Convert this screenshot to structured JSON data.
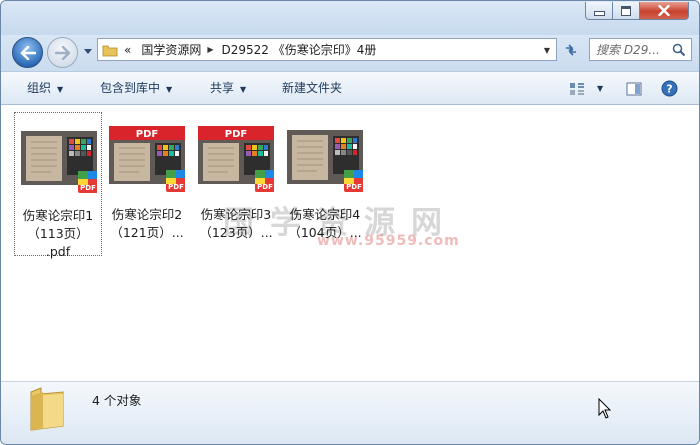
{
  "window": {
    "controls": {
      "minimize_icon": "minimize-icon",
      "maximize_icon": "maximize-icon",
      "close_icon": "close-icon"
    }
  },
  "nav": {
    "back_icon": "back-arrow-icon",
    "forward_icon": "forward-arrow-icon",
    "breadcrumb_overflow": "«",
    "breadcrumb": [
      "国学资源网",
      "D29522 《伤寒论宗印》4册"
    ],
    "search_placeholder": "搜索 D29..."
  },
  "toolbar": {
    "organize": "组织",
    "include_in_library": "包含到库中",
    "share": "共享",
    "new_folder": "新建文件夹"
  },
  "files": [
    {
      "line1": "伤寒论宗印1",
      "line2": "（113页）",
      "line3": ".pdf",
      "selected": true,
      "badge": "",
      "badge_color": ""
    },
    {
      "line1": "伤寒论宗印2",
      "line2": "（121页）...",
      "line3": "",
      "selected": false,
      "badge": "PDF",
      "badge_color": "#d9242b"
    },
    {
      "line1": "伤寒论宗印3",
      "line2": "（123页）...",
      "line3": "",
      "selected": false,
      "badge": "PDF",
      "badge_color": "#d9242b"
    },
    {
      "line1": "伤寒论宗印4",
      "line2": "（104页）...",
      "line3": "",
      "selected": false,
      "badge": "",
      "badge_color": ""
    }
  ],
  "watermark": {
    "text": "国学资源网",
    "url": "www.95959.com"
  },
  "status": {
    "count_text": "4 个对象"
  },
  "colors": {
    "accent": "#1e395b",
    "pdf_red": "#d9242b"
  }
}
